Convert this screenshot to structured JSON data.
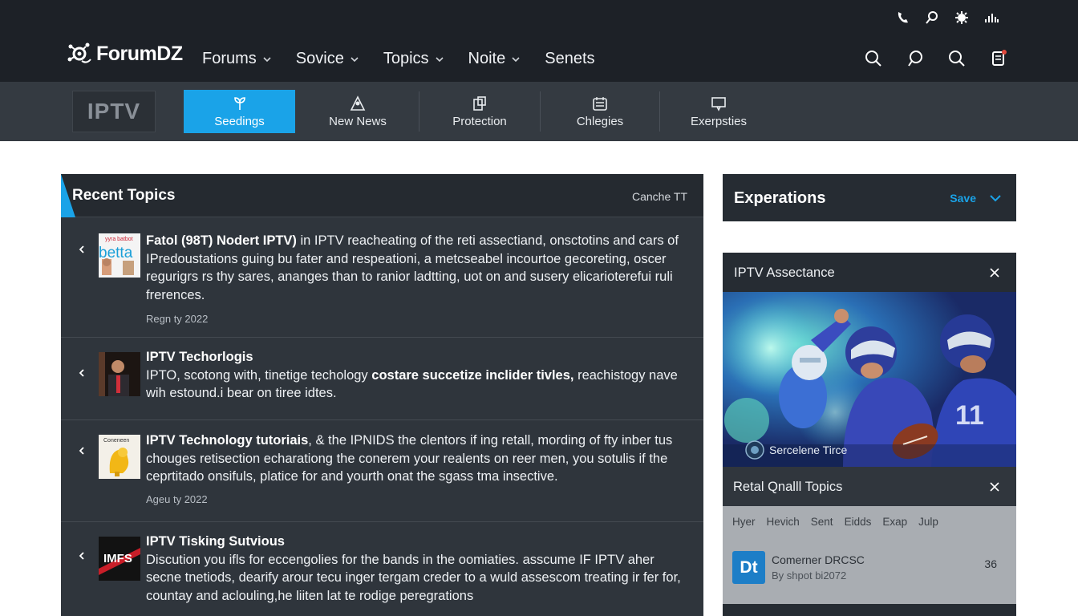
{
  "header": {
    "logo_text": "ForumDZ",
    "nav": [
      {
        "label": "Forums",
        "has_dropdown": true
      },
      {
        "label": "Sovice",
        "has_dropdown": true
      },
      {
        "label": "Topics",
        "has_dropdown": true
      },
      {
        "label": "Noite",
        "has_dropdown": true
      },
      {
        "label": "Senets",
        "has_dropdown": false
      }
    ],
    "utility_icons": [
      "phone-icon",
      "search-icon",
      "settings-icon",
      "signal-icon"
    ],
    "action_icons": [
      "search-icon",
      "chat-icon",
      "search-icon",
      "notification-icon"
    ],
    "notification_dot_color": "#e0483c"
  },
  "subnav": {
    "badge": "IPTV",
    "tabs": [
      {
        "label": "Seedings",
        "icon": "seedling-icon",
        "active": true
      },
      {
        "label": "New News",
        "icon": "triangle-user-icon",
        "active": false
      },
      {
        "label": "Protection",
        "icon": "shield-box-icon",
        "active": false
      },
      {
        "label": "Chlegies",
        "icon": "calendar-icon",
        "active": false
      },
      {
        "label": "Exerpsties",
        "icon": "message-icon",
        "active": false
      }
    ],
    "accent_color": "#1aa3e8"
  },
  "recent": {
    "title": "Recent Topics",
    "action": "Canche TT",
    "topics": [
      {
        "title": "Fatol (98T) Nodert IPTV)",
        "text": " in IPTV reacheating of the reti assectiand, onsctotins and cars of IPredoustations guing bu fater and respeationi, a metcseabel incourtoe gecoreting, oscer regurigrs rs thy sares, ananges than to ranior ladtting, uot on and susery elicarioterefui ruli frerences.",
        "date": "Regn ty 2022",
        "thumb_text": "yyra batbot betta"
      },
      {
        "title": "IPTV Techorlogis",
        "text": "IPTO, scotong with, tinetige techology ",
        "bold_text": "costare succetize inclider tivles,",
        "text_after": " reachistogy nave wih estound.i bear on tiree idtes.",
        "date": ""
      },
      {
        "title": "IPTV Technology tutoriais",
        "text": ", & the IPNIDS the clentors if ing retall, mording of fty inber tus chouges retisection echarationg the conerem your realents on reer men, you sotulis if the ceprtitado onsifuls, platice for and yourth onat the sgass tma insective.",
        "date": "Ageu ty 2022",
        "thumb_text": "Coneneen"
      },
      {
        "title": "IPTV Tisking Sutvious",
        "text": "Discution you ifls for eccengolies for the bands in the oomiaties. asscume IF IPTV aher secne tnetiods, dearify arour tecu inger tergam creder to a wuld assescom treating ir fer for, countay and aclouling,he liiten lat te rodige peregrations",
        "date": "",
        "thumb_text": "IMFS"
      }
    ]
  },
  "experations": {
    "title": "Experations",
    "save_label": "Save"
  },
  "assistance": {
    "title": "IPTV Assectance",
    "hero_caption": "Sercelene Tirce",
    "retail_title": "Retal Qnalll Topics",
    "filters": [
      "Hyer",
      "Hevich",
      "Sent",
      "Eidds",
      "Exap",
      "Julp"
    ],
    "result": {
      "logo": "Dt",
      "name": "Comerner DRCSC",
      "sub": "By shpot bi2072",
      "count": "36"
    }
  }
}
